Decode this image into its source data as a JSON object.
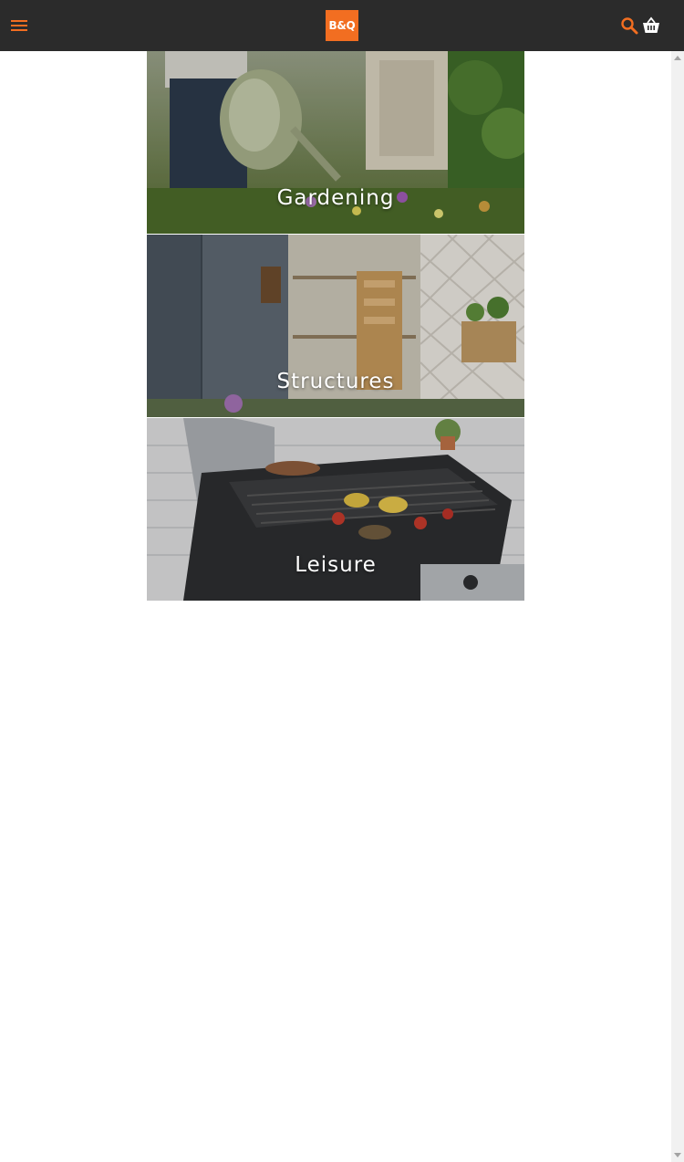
{
  "header": {
    "logo_text": "B&Q",
    "menu_icon": "hamburger-menu-icon",
    "search_icon": "search-icon",
    "basket_icon": "basket-icon",
    "accent_color": "#f26e21",
    "background_color": "#2b2b2b"
  },
  "categories": [
    {
      "label": "Gardening"
    },
    {
      "label": "Structures"
    },
    {
      "label": "Leisure"
    }
  ]
}
